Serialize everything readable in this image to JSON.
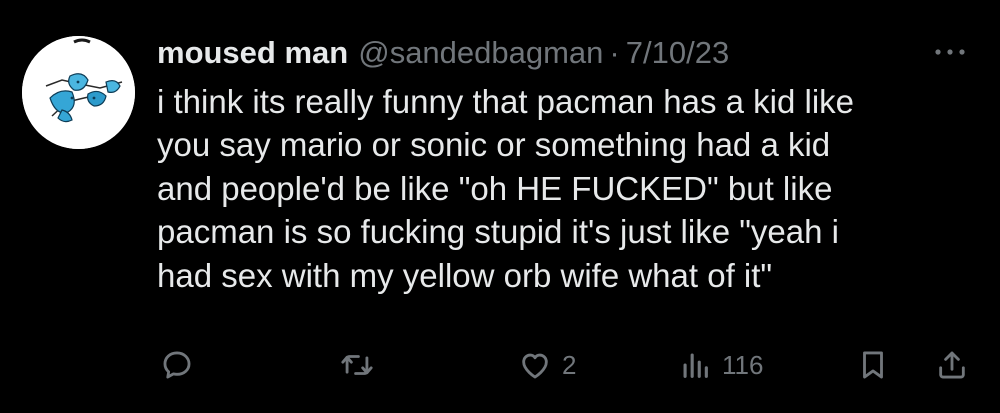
{
  "tweet": {
    "author_name": "moused man",
    "handle": "@sandedbagman",
    "separator": "·",
    "date": "7/10/23",
    "text_lines": [
      "i think its really funny that pacman has a kid like",
      "you say mario or sonic or something had a kid",
      "and people'd be like \"oh HE FUCKED\" but like",
      "pacman is so fucking stupid it's just like \"yeah i",
      "had sex with my yellow orb wife what of it\""
    ]
  },
  "actions": {
    "likes": "2",
    "views": "116"
  },
  "icons": {
    "reply": "reply-icon",
    "retweet": "retweet-icon",
    "like": "heart-icon",
    "views": "views-icon",
    "bookmark": "bookmark-icon",
    "share": "share-icon",
    "more": "more-icon"
  },
  "colors": {
    "background": "#000000",
    "text": "#e7e9ea",
    "muted": "#71767b"
  }
}
